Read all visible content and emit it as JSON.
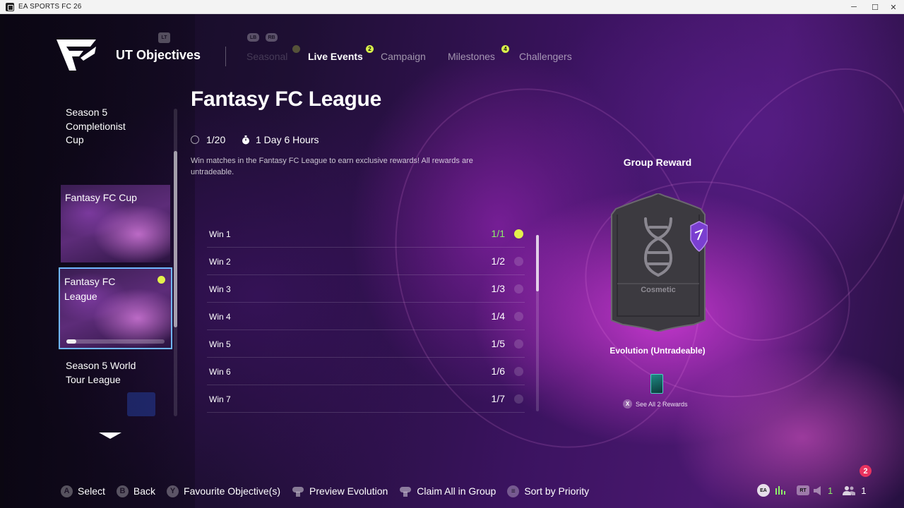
{
  "window": {
    "title": "EA SPORTS FC 26",
    "controls": {
      "minimize": "─",
      "maximize": "☐",
      "close": "✕"
    }
  },
  "header": {
    "title": "UT Objectives",
    "button_hints": {
      "lt": "LT",
      "lb": "LB",
      "rb": "RB"
    },
    "tabs": [
      {
        "label": "Seasonal",
        "badge": "",
        "state": "disabled"
      },
      {
        "label": "Live Events",
        "badge": "2",
        "state": "active"
      },
      {
        "label": "Campaign",
        "badge": "",
        "state": "inactive"
      },
      {
        "label": "Milestones",
        "badge": "4",
        "state": "inactive"
      },
      {
        "label": "Challengers",
        "badge": "",
        "state": "inactive"
      }
    ]
  },
  "sidebar": {
    "items": [
      {
        "label": "Season 5 Completionist Cup",
        "type": "text"
      },
      {
        "label": "Fantasy FC Cup",
        "type": "card"
      },
      {
        "label": "Fantasy FC League",
        "type": "card",
        "selected": true,
        "progress": 0.1
      },
      {
        "label": "Season 5 World Tour League",
        "type": "text"
      }
    ]
  },
  "main": {
    "title": "Fantasy FC League",
    "progress_text": "1/20",
    "time_left": "1 Day 6 Hours",
    "description": "Win matches in the Fantasy FC League to earn exclusive rewards! All rewards are untradeable.",
    "objectives": [
      {
        "name": "Win 1",
        "count": "1/1",
        "completed": true
      },
      {
        "name": "Win 2",
        "count": "1/2",
        "completed": false
      },
      {
        "name": "Win 3",
        "count": "1/3",
        "completed": false
      },
      {
        "name": "Win 4",
        "count": "1/4",
        "completed": false
      },
      {
        "name": "Win 5",
        "count": "1/5",
        "completed": false
      },
      {
        "name": "Win 6",
        "count": "1/6",
        "completed": false
      },
      {
        "name": "Win 7",
        "count": "1/7",
        "completed": false
      }
    ]
  },
  "reward": {
    "heading": "Group Reward",
    "card_label": "Cosmetic",
    "name": "Evolution (Untradeable)",
    "see_all_button": "X",
    "see_all": "See All 2 Rewards"
  },
  "footer": {
    "actions": [
      {
        "button": "A",
        "label": "Select"
      },
      {
        "button": "B",
        "label": "Back"
      },
      {
        "button": "Y",
        "label": "Favourite Objective(s)"
      },
      {
        "button": "R-stick",
        "label": "Preview Evolution"
      },
      {
        "button": "L-stick",
        "label": "Claim All in Group"
      },
      {
        "button": "menu",
        "label": "Sort by Priority"
      }
    ],
    "status": {
      "ea": "EA",
      "rt": "RT",
      "voice_count": "1",
      "friends_count": "1",
      "notifications": "2"
    }
  },
  "colors": {
    "accent_yellow": "#e3f04c",
    "completed_green": "#8df06a",
    "selection_blue": "#6fb6ff",
    "notification_red": "#e8335f"
  }
}
